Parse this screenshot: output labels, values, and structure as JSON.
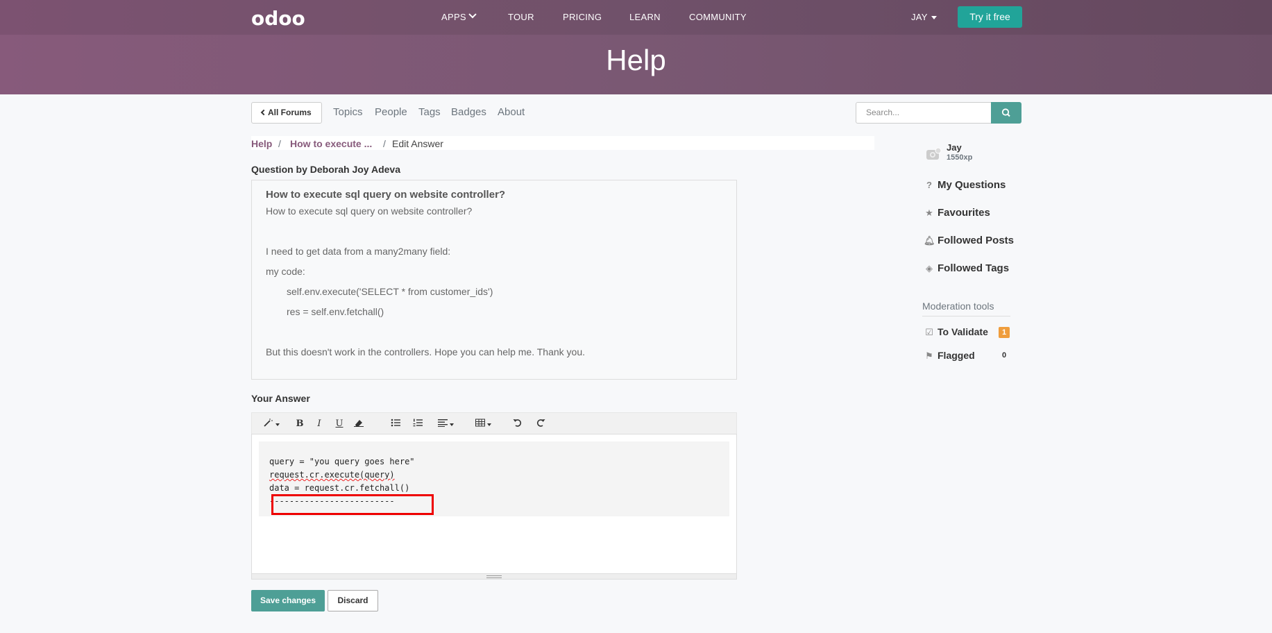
{
  "header": {
    "logo": "odoo",
    "nav": [
      "APPS",
      "TOUR",
      "PRICING",
      "LEARN",
      "COMMUNITY"
    ],
    "user": "JAY",
    "try_button": "Try it free",
    "title": "Help"
  },
  "subnav": {
    "all_forums": "All Forums",
    "items": [
      "Topics",
      "People",
      "Tags",
      "Badges",
      "About"
    ],
    "search_placeholder": "Search..."
  },
  "breadcrumb": {
    "root": "Help",
    "question": "How to execute ...",
    "current": "Edit Answer"
  },
  "question": {
    "by": "Question by Deborah Joy Adeva",
    "title": "How to execute sql query on website controller?",
    "lines": [
      "How to execute sql query on website controller?",
      "I need to get data from a many2many field:",
      "my code:",
      "self.env.execute('SELECT * from customer_ids')",
      "res = self.env.fetchall()",
      "But this doesn't work in the controllers. Hope you can help me. Thank you."
    ]
  },
  "answer": {
    "label": "Your Answer",
    "code": [
      "query = \"you query goes here\"",
      "request.cr.execute(query)",
      "data = request.cr.fetchall()",
      "-------------------------"
    ],
    "save_button": "Save changes",
    "discard_button": "Discard"
  },
  "sidebar": {
    "user_name": "Jay",
    "user_xp": "1550xp",
    "items": [
      "My Questions",
      "Favourites",
      "Followed Posts",
      "Followed Tags"
    ],
    "moderation_title": "Moderation tools",
    "to_validate": "To Validate",
    "to_validate_count": "1",
    "flagged": "Flagged",
    "flagged_count": "0"
  },
  "colors": {
    "header": "#875a7b",
    "accent": "#4e9f96",
    "link": "#875a7b",
    "badge": "#ef9d3c"
  }
}
